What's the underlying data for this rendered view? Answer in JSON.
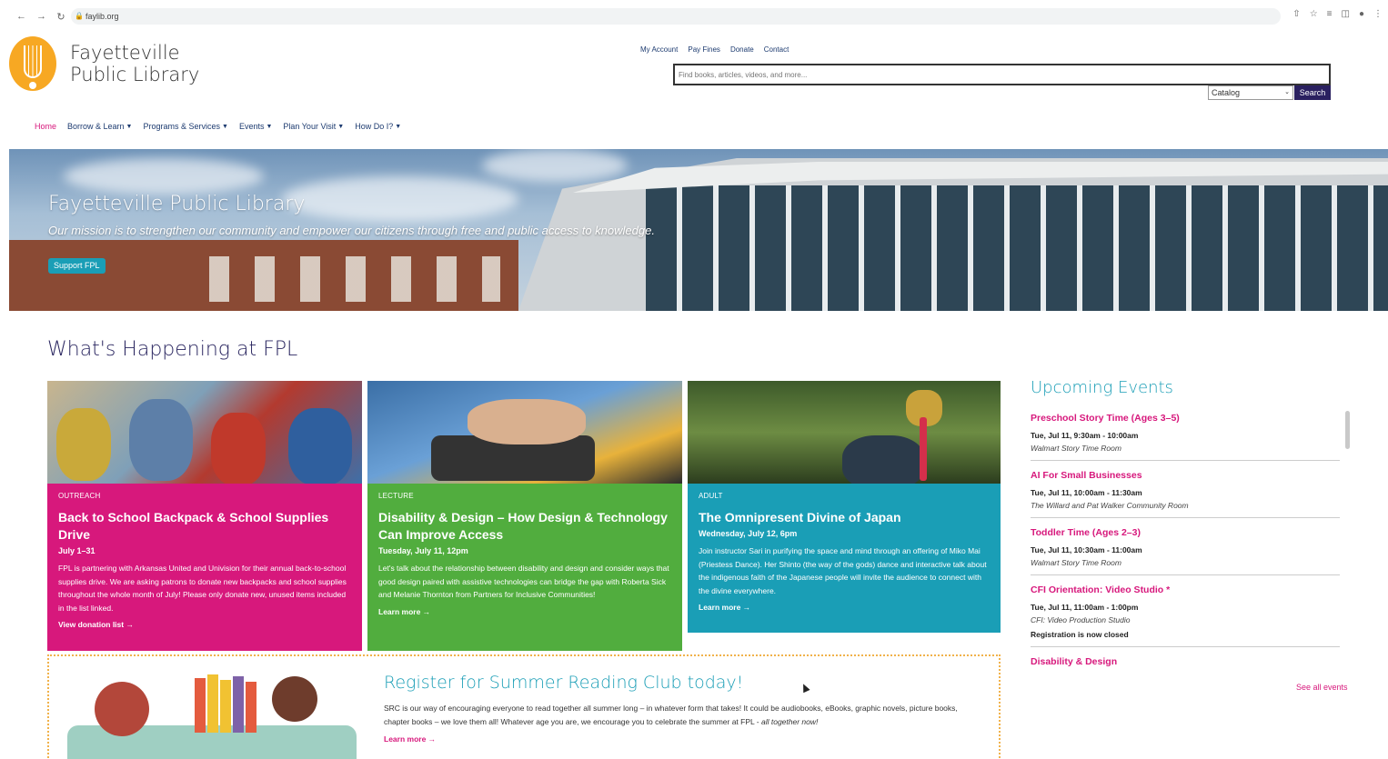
{
  "browser": {
    "url": "faylib.org",
    "nav": [
      "←",
      "→",
      "↻"
    ]
  },
  "logo": {
    "line1": "Fayetteville",
    "line2": "Public Library"
  },
  "util_links": [
    "My Account",
    "Pay Fines",
    "Donate",
    "Contact"
  ],
  "search": {
    "placeholder": "Find books, articles, videos, and more...",
    "scope": "Catalog",
    "button": "Search"
  },
  "main_nav": [
    {
      "label": "Home",
      "active": true
    },
    {
      "label": "Borrow & Learn"
    },
    {
      "label": "Programs & Services"
    },
    {
      "label": "Events"
    },
    {
      "label": "Plan Your Visit"
    },
    {
      "label": "How Do I?"
    }
  ],
  "hero": {
    "title": "Fayetteville Public Library",
    "tagline": "Our mission is to strengthen our community and empower our citizens through free and public access to knowledge.",
    "button": "Support FPL"
  },
  "section_title": "What's Happening at FPL",
  "cards": [
    {
      "category": "OUTREACH",
      "title": "Back to School Backpack & School Supplies Drive",
      "date": "July 1–31",
      "description": "FPL is partnering with Arkansas United and Univision for their annual back-to-school supplies drive. We are asking patrons to donate new backpacks and school supplies throughout the whole month of July! Please only donate new, unused items included in the list linked.",
      "link": "View donation list →"
    },
    {
      "category": "LECTURE",
      "title": "Disability & Design – How Design & Technology Can Improve Access",
      "date": "Tuesday, July 11, 12pm",
      "description": "Let's talk about the relationship between disability and design and consider ways that good design paired with assistive technologies can bridge the gap with Roberta Sick and Melanie Thornton from Partners for Inclusive Communities!",
      "link": "Learn more →"
    },
    {
      "category": "ADULT",
      "title": "The Omnipresent Divine of Japan",
      "date": "Wednesday, July 12, 6pm",
      "description": "Join instructor Sari in purifying the space and mind through an offering of Miko Mai (Priestess Dance). Her Shinto (the way of the gods) dance and interactive talk about the indigenous faith of the Japanese people will invite the audience to connect with the divine everywhere.",
      "link": "Learn more →"
    }
  ],
  "summer_reading": {
    "title": "Register for Summer Reading Club today!",
    "description": "SRC is our way of encouraging everyone to read together all summer long – in whatever form that takes! It could be audiobooks, eBooks, graphic novels, picture books, chapter books – we love them all! Whatever age you are, we encourage you to celebrate the summer at FPL - ",
    "description_em": "all together now!",
    "link": "Learn more →"
  },
  "events": {
    "title": "Upcoming Events",
    "items": [
      {
        "name": "Preschool Story Time (Ages 3–5)",
        "time": "Tue, Jul 11, 9:30am - 10:00am",
        "location": "Walmart Story Time Room"
      },
      {
        "name": "AI For Small Businesses",
        "time": "Tue, Jul 11, 10:00am - 11:30am",
        "location": "The Willard and Pat Walker Community Room"
      },
      {
        "name": "Toddler Time (Ages 2–3)",
        "time": "Tue, Jul 11, 10:30am - 11:00am",
        "location": "Walmart Story Time Room"
      },
      {
        "name": "CFI Orientation: Video Studio *",
        "time": "Tue, Jul 11, 11:00am - 1:00pm",
        "location": "CFI: Video Production Studio",
        "note": "Registration is now closed"
      },
      {
        "name": "Disability & Design"
      }
    ],
    "see_all": "See all events"
  },
  "colors": {
    "pink": "#d7187c",
    "green": "#51ad3e",
    "teal": "#1a9eb6",
    "navy": "#2a2660",
    "logo_orange": "#f7a823"
  }
}
